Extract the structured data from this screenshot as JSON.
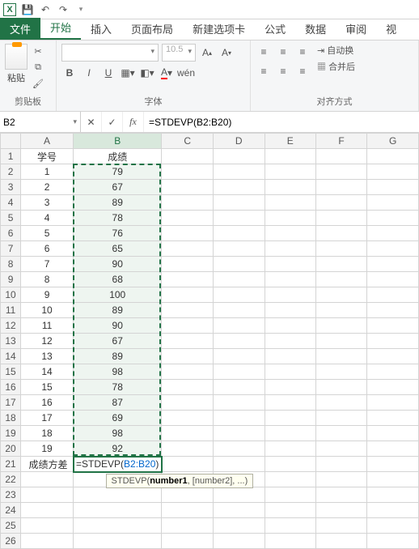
{
  "titlebar": {
    "app_icon": "X"
  },
  "tabs": {
    "file": "文件",
    "items": [
      "开始",
      "插入",
      "页面布局",
      "新建选项卡",
      "公式",
      "数据",
      "审阅",
      "视"
    ],
    "active_index": 0
  },
  "ribbon": {
    "clipboard": {
      "paste": "粘贴",
      "group": "剪贴板"
    },
    "font": {
      "name_placeholder": "",
      "size": "10.5",
      "group": "字体",
      "buttons": {
        "b": "B",
        "i": "I",
        "u": "U",
        "wen": "wén"
      }
    },
    "alignment": {
      "group": "对齐方式",
      "wrap": "自动换",
      "merge": "合并后"
    }
  },
  "formula_bar": {
    "name": "B2",
    "formula": "=STDEVP(B2:B20)"
  },
  "sheet": {
    "cols": [
      "A",
      "B",
      "C",
      "D",
      "E",
      "F",
      "G"
    ],
    "rows": [
      {
        "n": 1,
        "a": "学号",
        "b": "成绩"
      },
      {
        "n": 2,
        "a": "1",
        "b": "79"
      },
      {
        "n": 3,
        "a": "2",
        "b": "67"
      },
      {
        "n": 4,
        "a": "3",
        "b": "89"
      },
      {
        "n": 5,
        "a": "4",
        "b": "78"
      },
      {
        "n": 6,
        "a": "5",
        "b": "76"
      },
      {
        "n": 7,
        "a": "6",
        "b": "65"
      },
      {
        "n": 8,
        "a": "7",
        "b": "90"
      },
      {
        "n": 9,
        "a": "8",
        "b": "68"
      },
      {
        "n": 10,
        "a": "9",
        "b": "100"
      },
      {
        "n": 11,
        "a": "10",
        "b": "89"
      },
      {
        "n": 12,
        "a": "11",
        "b": "90"
      },
      {
        "n": 13,
        "a": "12",
        "b": "67"
      },
      {
        "n": 14,
        "a": "13",
        "b": "89"
      },
      {
        "n": 15,
        "a": "14",
        "b": "98"
      },
      {
        "n": 16,
        "a": "15",
        "b": "78"
      },
      {
        "n": 17,
        "a": "16",
        "b": "87"
      },
      {
        "n": 18,
        "a": "17",
        "b": "69"
      },
      {
        "n": 19,
        "a": "18",
        "b": "98"
      },
      {
        "n": 20,
        "a": "19",
        "b": "92"
      },
      {
        "n": 21,
        "a": "成绩方差",
        "b_formula_prefix": "=STDEVP(",
        "b_formula_ref": "B2:B20",
        "b_formula_suffix": ")"
      },
      {
        "n": 22
      },
      {
        "n": 23
      },
      {
        "n": 24
      },
      {
        "n": 25
      },
      {
        "n": 26
      }
    ]
  },
  "tooltip": {
    "fn": "STDEVP",
    "arg1": "number1",
    "rest": ", [number2], ...)"
  },
  "chart_data": {
    "type": "table",
    "columns": [
      "学号",
      "成绩"
    ],
    "rows": [
      [
        1,
        79
      ],
      [
        2,
        67
      ],
      [
        3,
        89
      ],
      [
        4,
        78
      ],
      [
        5,
        76
      ],
      [
        6,
        65
      ],
      [
        7,
        90
      ],
      [
        8,
        68
      ],
      [
        9,
        100
      ],
      [
        10,
        89
      ],
      [
        11,
        90
      ],
      [
        12,
        67
      ],
      [
        13,
        89
      ],
      [
        14,
        98
      ],
      [
        15,
        78
      ],
      [
        16,
        87
      ],
      [
        17,
        69
      ],
      [
        18,
        98
      ],
      [
        19,
        92
      ]
    ],
    "summary_label": "成绩方差",
    "summary_formula": "=STDEVP(B2:B20)"
  }
}
